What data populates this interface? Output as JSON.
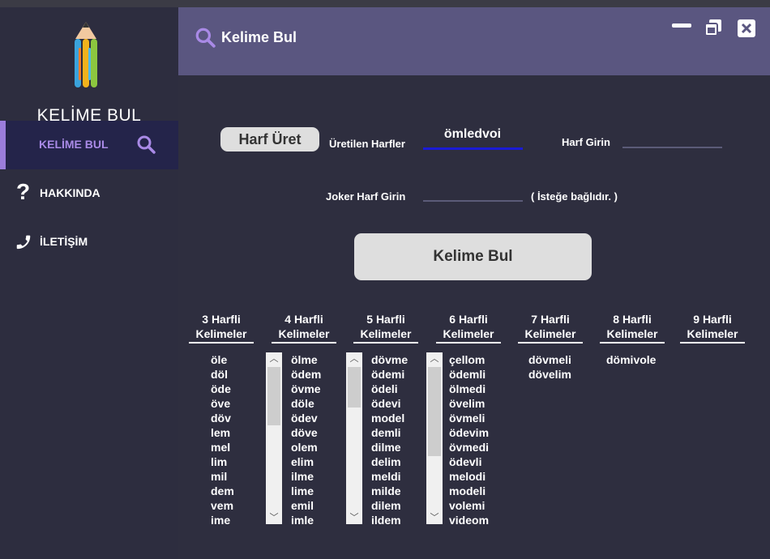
{
  "app": {
    "logo_text": "KELİME BUL",
    "header_title": "Kelime Bul"
  },
  "sidebar": {
    "items": [
      {
        "label": "KELİME BUL",
        "icon": "search-icon",
        "active": true
      },
      {
        "label": "HAKKINDA",
        "icon": "question-icon",
        "active": false
      },
      {
        "label": "İLETİŞİM",
        "icon": "phone-icon",
        "active": false
      }
    ]
  },
  "window_controls": {
    "minimize": "minimize-icon",
    "restore": "restore-icon",
    "close": "close-icon"
  },
  "form": {
    "generate_button": "Harf Üret",
    "generated_label": "Üretilen Harfler",
    "generated_value": "ömledvoi",
    "input_label": "Harf Girin",
    "input_value": "",
    "joker_label": "Joker Harf Girin",
    "joker_value": "",
    "optional_note": "( İsteğe bağlıdır. )",
    "find_button": "Kelime Bul"
  },
  "columns": [
    {
      "line1": "3 Harfli",
      "line2": "Kelimeler",
      "words": [
        "öle",
        "döl",
        "öde",
        "öve",
        "döv",
        "lem",
        "mel",
        "lim",
        "mil",
        "dem",
        "vem",
        "ime"
      ]
    },
    {
      "line1": "4 Harfli",
      "line2": "Kelimeler",
      "words": [
        "ölme",
        "ödem",
        "övme",
        "döle",
        "ödev",
        "döve",
        "olem",
        "elim",
        "ilme",
        "lime",
        "emil",
        "imle"
      ]
    },
    {
      "line1": "5 Harfli",
      "line2": "Kelimeler",
      "words": [
        "dövme",
        "ödemi",
        "ödeli",
        "ödevi",
        "model",
        "demli",
        "dilme",
        "delim",
        "meldi",
        "milde",
        "dilem",
        "ildem"
      ]
    },
    {
      "line1": "6 Harfli",
      "line2": "Kelimeler",
      "words": [
        "çellom",
        "ödemli",
        "ölmedi",
        "övelim",
        "övmeli",
        "ödevim",
        "övmedi",
        "ödevli",
        "melodi",
        "modeli",
        "volemi",
        "videom"
      ]
    },
    {
      "line1": "7 Harfli",
      "line2": "Kelimeler",
      "words": [
        "dövmeli",
        "dövelim"
      ]
    },
    {
      "line1": "8 Harfli",
      "line2": "Kelimeler",
      "words": [
        "dömivole"
      ]
    },
    {
      "line1": "9 Harfli",
      "line2": "Kelimeler",
      "words": []
    }
  ],
  "colors": {
    "accent": "#9b7ddb",
    "header": "#5a5680",
    "sidebar": "#2d2d3f",
    "content": "#2e2e3f",
    "active_input_underline": "#1a1ad6"
  }
}
